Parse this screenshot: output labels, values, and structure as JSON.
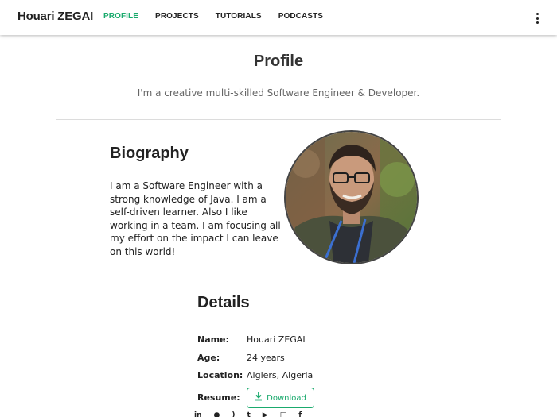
{
  "nav": {
    "brand": "Houari ZEGAI",
    "links": [
      "PROFILE",
      "PROJECTS",
      "TUTORIALS",
      "PODCASTS"
    ],
    "active_index": 0,
    "menu_icon": "more-vert-icon"
  },
  "profile": {
    "title": "Profile",
    "tagline": "I'm a creative multi-skilled Software Engineer & Developer."
  },
  "biography": {
    "heading": "Biography",
    "text": "I am a Software Engineer with a strong knowledge of Java. I am a self-driven learner. Also I like working in a team. I am focusing all my effort on the impact I can leave on this world!"
  },
  "details": {
    "heading": "Details",
    "rows": [
      {
        "label": "Name:",
        "value": "Houari ZEGAI"
      },
      {
        "label": "Age:",
        "value": "24 years"
      },
      {
        "label": "Location:",
        "value": "Algiers, Algeria"
      },
      {
        "label": "Resume:",
        "value": ""
      }
    ],
    "download_label": "Download"
  },
  "social_icons": [
    "linkedin-icon",
    "github-icon",
    "rss-icon",
    "twitter-icon",
    "youtube-icon",
    "instagram-icon",
    "facebook-icon"
  ],
  "colors": {
    "accent": "#1aaa6d",
    "text": "#222222",
    "muted": "#666666"
  }
}
